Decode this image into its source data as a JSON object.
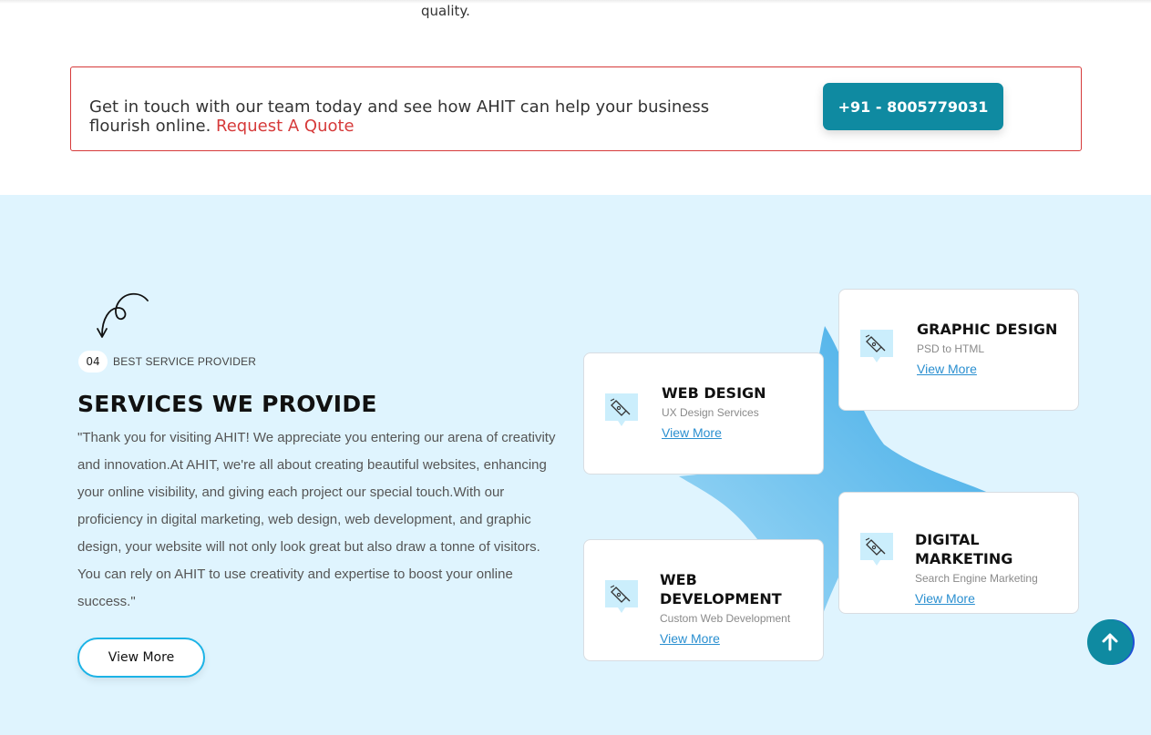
{
  "top": {
    "quality_text": "quality."
  },
  "cta": {
    "text": "Get in touch with our team today and see how AHIT can help your business flourish online.",
    "link_label": "Request A Quote",
    "phone_label": "+91 - 8005779031"
  },
  "services": {
    "badge_number": "04",
    "badge_label": "BEST SERVICE PROVIDER",
    "heading": "SERVICES WE PROVIDE",
    "paragraph": "\"Thank you for visiting AHIT! We appreciate you entering our arena of creativity and innovation.At AHIT, we're all about creating beautiful websites, enhancing your online visibility, and giving each project our special touch.With our proficiency in digital marketing, web design, web development, and graphic design, your website will not only look great but also draw a tonne of visitors. You can rely on AHIT to use creativity and expertise to boost your online success.\"",
    "view_more_label": "View More",
    "cards": [
      {
        "title": "WEB DESIGN",
        "subtitle": "UX Design Services",
        "link": "View More",
        "icon": "pen-tool-icon"
      },
      {
        "title": "GRAPHIC DESIGN",
        "subtitle": "PSD to HTML",
        "link": "View More",
        "icon": "pen-tool-icon"
      },
      {
        "title": "WEB DEVELOPMENT",
        "subtitle": "Custom Web Development",
        "link": "View More",
        "icon": "pen-tool-icon"
      },
      {
        "title": "DIGITAL MARKETING",
        "subtitle": "Search Engine Marketing",
        "link": "View More",
        "icon": "pen-tool-icon"
      }
    ]
  },
  "colors": {
    "accent_teal": "#0f8aa1",
    "accent_red": "#d63a3a",
    "section_bg": "#dff4fe",
    "link_blue": "#2a8fd0"
  },
  "scroll_top_icon": "arrow-up-icon"
}
